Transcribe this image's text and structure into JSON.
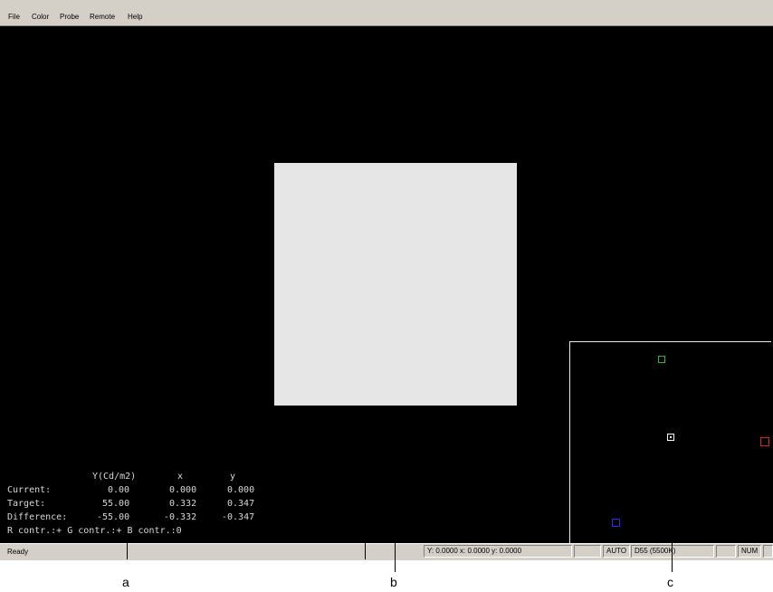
{
  "menu": [
    "File",
    "Color",
    "Probe",
    "Remote",
    "Help"
  ],
  "readout": {
    "headers": {
      "y_lum": "Y(Cd/m2)",
      "x": "x",
      "y": "y"
    },
    "rows": [
      {
        "label": "Current:",
        "Y": "0.00",
        "x": "0.000",
        "y": "0.000"
      },
      {
        "label": "Target:",
        "Y": "55.00",
        "x": "0.332",
        "y": "0.347"
      },
      {
        "label": "Difference:",
        "Y": "-55.00",
        "x": "-0.332",
        "y": "-0.347"
      }
    ],
    "contrast": "R contr.:+ G contr.:+ B contr.:0"
  },
  "status": {
    "ready": "Ready",
    "coords": "Y: 0.0000 x: 0.0000 y: 0.0000",
    "mode": "AUTO",
    "illuminant": "D55 (5500K)",
    "num": "NUM"
  },
  "callouts": {
    "a": "a",
    "b": "b",
    "c": "c"
  },
  "colors": {
    "background": "#000000",
    "patch": "#e6e6e6",
    "marker_green": "#1fbf1f",
    "marker_red": "#e02020",
    "marker_blue": "#2a2aff",
    "marker_white": "#ffffff"
  }
}
